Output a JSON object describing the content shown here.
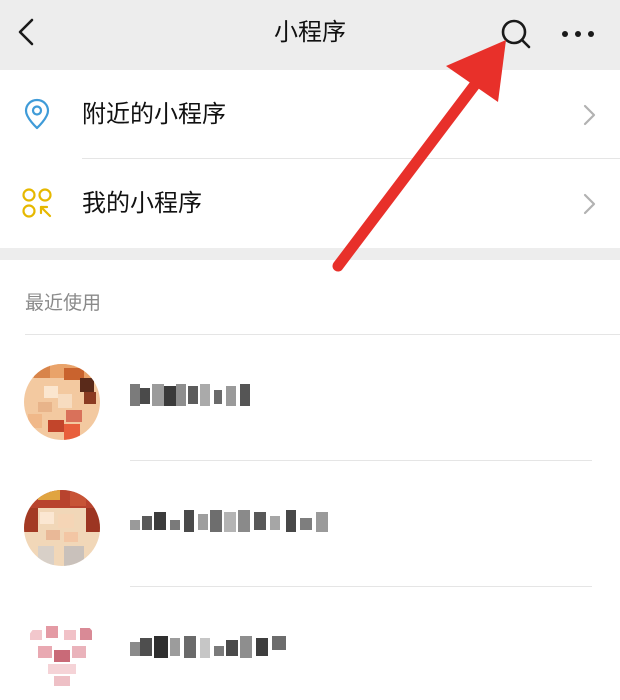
{
  "header": {
    "title": "小程序",
    "back_icon": "chevron-left-icon",
    "search_icon": "search-icon",
    "more_icon": "more-dots-icon"
  },
  "menu": {
    "items": [
      {
        "label": "附近的小程序",
        "icon": "location-pin-icon",
        "icon_color": "#3f9bd8"
      },
      {
        "label": "我的小程序",
        "icon": "my-miniprograms-icon",
        "icon_color": "#e6b800"
      }
    ]
  },
  "recent": {
    "header": "最近使用"
  },
  "colors": {
    "header_bg": "#ededed",
    "annotation_arrow": "#e8302a",
    "secondary_text": "#8a8a8a"
  }
}
